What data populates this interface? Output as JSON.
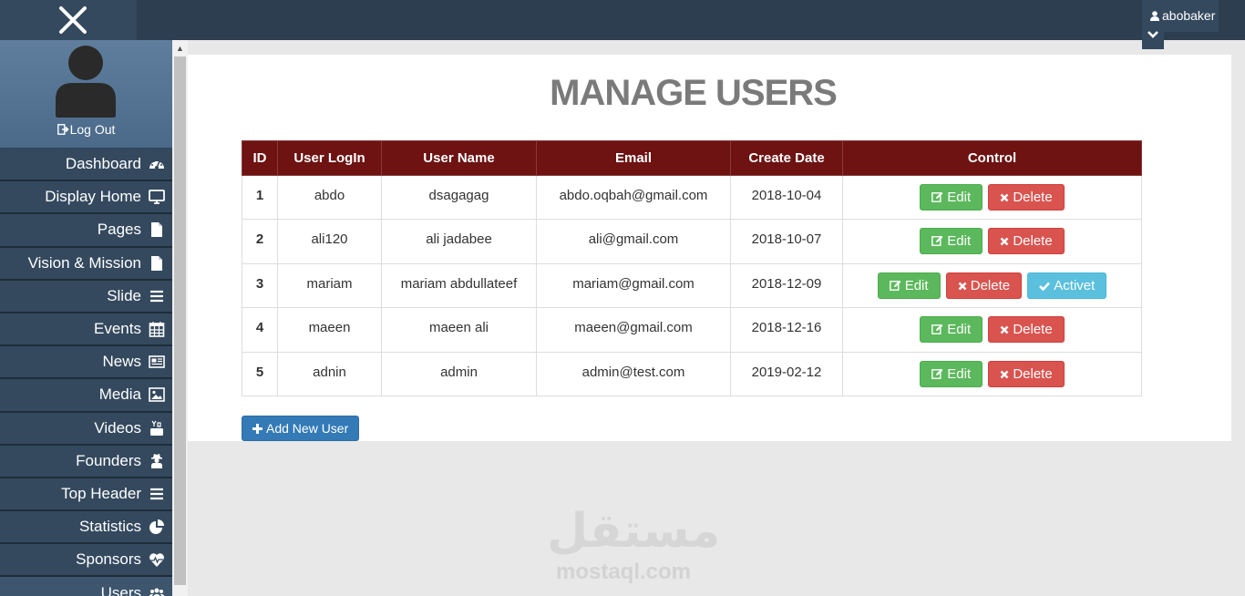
{
  "topbar": {
    "username": "abobaker"
  },
  "sidebar": {
    "logout_label": "Log Out",
    "items": [
      {
        "label": "Dashboard",
        "icon": "dashboard-icon"
      },
      {
        "label": "Display Home",
        "icon": "monitor-icon"
      },
      {
        "label": "Pages",
        "icon": "file-icon"
      },
      {
        "label": "Vision & Mission",
        "icon": "file-icon"
      },
      {
        "label": "Slide",
        "icon": "bars-icon"
      },
      {
        "label": "Events",
        "icon": "calendar-icon"
      },
      {
        "label": "News",
        "icon": "newspaper-icon"
      },
      {
        "label": "Media",
        "icon": "image-icon"
      },
      {
        "label": "Videos",
        "icon": "youtube-icon"
      },
      {
        "label": "Founders",
        "icon": "user-secret-icon"
      },
      {
        "label": "Top Header",
        "icon": "bars-icon"
      },
      {
        "label": "Statistics",
        "icon": "pie-chart-icon"
      },
      {
        "label": "Sponsors",
        "icon": "heartbeat-icon"
      },
      {
        "label": "Users",
        "icon": "users-icon"
      }
    ]
  },
  "main": {
    "title": "MANAGE USERS",
    "columns": [
      "ID",
      "User LogIn",
      "User Name",
      "Email",
      "Create Date",
      "Control"
    ],
    "rows": [
      {
        "id": "1",
        "login": "abdo",
        "name": "dsagagag",
        "email": "abdo.oqbah@gmail.com",
        "date": "2018-10-04"
      },
      {
        "id": "2",
        "login": "ali120",
        "name": "ali jadabee",
        "email": "ali@gmail.com",
        "date": "2018-10-07"
      },
      {
        "id": "3",
        "login": "mariam",
        "name": "mariam abdullateef",
        "email": "mariam@gmail.com",
        "date": "2018-12-09"
      },
      {
        "id": "4",
        "login": "maeen",
        "name": "maeen ali",
        "email": "maeen@gmail.com",
        "date": "2018-12-16"
      },
      {
        "id": "5",
        "login": "adnin",
        "name": "admin",
        "email": "admin@test.com",
        "date": "2019-02-12"
      }
    ],
    "edit_label": "Edit",
    "delete_label": "Delete",
    "activate_label": "Activet",
    "add_label": "Add New User"
  },
  "watermark": {
    "arabic": "مستقل",
    "latin": "mostaql.com"
  },
  "colors": {
    "topbar": "#2c3e50",
    "sidebar": "#34495e",
    "table_header": "#6e1212",
    "edit": "#5cb85c",
    "delete": "#d9534f",
    "activate": "#5bc0de",
    "add": "#337ab7"
  }
}
